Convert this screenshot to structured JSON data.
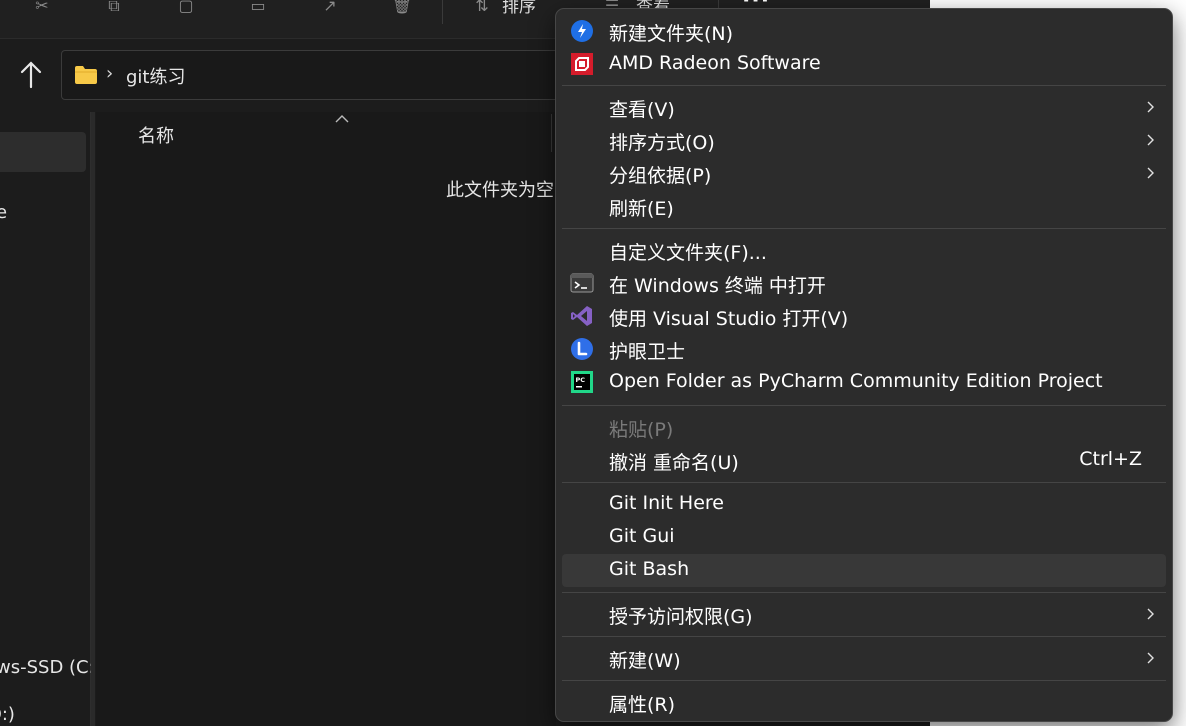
{
  "toolbar": {
    "sort_label": "排序",
    "view_label": "查看",
    "more_label": "···"
  },
  "address": {
    "path": "git练习"
  },
  "nav": {
    "fragment_1": "e",
    "fragment_2": "ws-SSD (C:",
    "fragment_3": "D:)"
  },
  "content": {
    "column_name": "名称",
    "empty_message": "此文件夹为空"
  },
  "menu": {
    "items": [
      {
        "label": "新建文件夹(N)",
        "icon": "new-folder-icon"
      },
      {
        "label": "AMD Radeon Software",
        "icon": "amd-icon"
      },
      {
        "label": "查看(V)",
        "submenu": true
      },
      {
        "label": "排序方式(O)",
        "submenu": true
      },
      {
        "label": "分组依据(P)",
        "submenu": true
      },
      {
        "label": "刷新(E)"
      },
      {
        "label": "自定义文件夹(F)..."
      },
      {
        "label": "在 Windows 终端 中打开",
        "icon": "terminal-icon"
      },
      {
        "label": "使用 Visual Studio 打开(V)",
        "icon": "visual-studio-icon"
      },
      {
        "label": "护眼卫士",
        "icon": "eye-guard-icon"
      },
      {
        "label": "Open Folder as PyCharm Community Edition Project",
        "icon": "pycharm-icon"
      },
      {
        "label": "粘贴(P)",
        "disabled": true
      },
      {
        "label": "撤消 重命名(U)",
        "shortcut": "Ctrl+Z"
      },
      {
        "label": "Git Init Here"
      },
      {
        "label": "Git Gui"
      },
      {
        "label": "Git Bash",
        "highlighted": true
      },
      {
        "label": "授予访问权限(G)",
        "submenu": true
      },
      {
        "label": "新建(W)",
        "submenu": true
      },
      {
        "label": "属性(R)"
      }
    ]
  },
  "colors": {
    "menu_bg": "#2c2c2c",
    "highlight": "#383838",
    "window_bg": "#1c1c1c",
    "folder": "#f7c948",
    "amd_red": "#d51c2b",
    "vs_purple": "#8661c5",
    "accent_blue": "#1f6fe5"
  }
}
